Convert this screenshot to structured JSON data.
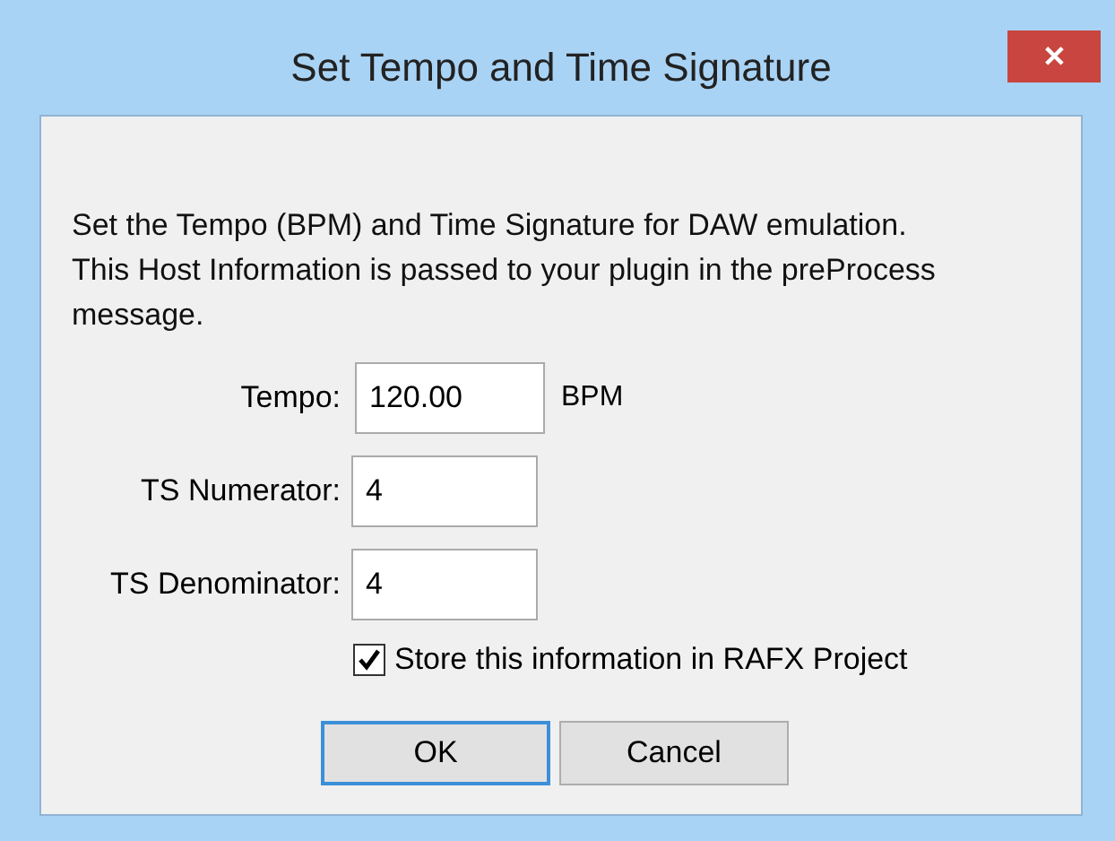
{
  "window": {
    "title": "Set Tempo and Time Signature",
    "close": "✕"
  },
  "description": [
    "Set the Tempo (BPM) and Time Signature for DAW emulation.",
    "This Host Information is passed to your plugin in the preProcess",
    "message."
  ],
  "fields": [
    {
      "label": "Tempo:",
      "value": "120.00",
      "unit": "BPM"
    },
    {
      "label": "TS Numerator:",
      "value": "4"
    },
    {
      "label": "TS Denominator:",
      "value": "4"
    }
  ],
  "checkbox": {
    "label": "Store this information in RAFX Project",
    "checked": true
  },
  "buttons": [
    {
      "label": "OK",
      "default": true
    },
    {
      "label": "Cancel",
      "default": false
    }
  ]
}
